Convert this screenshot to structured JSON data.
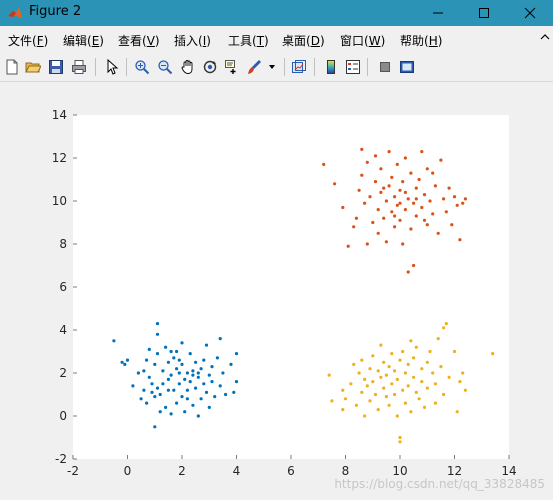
{
  "window": {
    "title": "Figure 2",
    "title_bar_color": "#2b93b5"
  },
  "menu": [
    {
      "label": "文件(",
      "key": "F",
      "end": ")"
    },
    {
      "label": "编辑(",
      "key": "E",
      "end": ")"
    },
    {
      "label": "查看(",
      "key": "V",
      "end": ")"
    },
    {
      "label": "插入(",
      "key": "I",
      "end": ")"
    },
    {
      "label": "工具(",
      "key": "T",
      "end": ")"
    },
    {
      "label": "桌面(",
      "key": "D",
      "end": ")"
    },
    {
      "label": "窗口(",
      "key": "W",
      "end": ")"
    },
    {
      "label": "帮助(",
      "key": "H",
      "end": ")"
    }
  ],
  "toolbar_icons": [
    "new-figure-icon",
    "open-file-icon",
    "save-icon",
    "print-icon",
    "pointer-icon",
    "zoom-in-icon",
    "zoom-out-icon",
    "pan-icon",
    "rotate-3d-icon",
    "data-cursor-icon",
    "brush-icon",
    "dropdown-icon",
    "link-plot-icon",
    "colorbar-icon",
    "legend-icon",
    "hide-plot-tools-icon",
    "show-plot-tools-icon"
  ],
  "watermark": "https://blog.csdn.net/qq_33828485",
  "chart_data": {
    "type": "scatter",
    "title": "",
    "xlabel": "",
    "ylabel": "",
    "xlim": [
      -2,
      14
    ],
    "ylim": [
      -2,
      14
    ],
    "xticks": [
      "-2",
      "0",
      "2",
      "4",
      "6",
      "8",
      "10",
      "12",
      "14"
    ],
    "yticks": [
      "-2",
      "0",
      "2",
      "4",
      "6",
      "8",
      "10",
      "12",
      "14"
    ],
    "grid": false,
    "series": [
      {
        "color": "#0072bd",
        "points": [
          [
            -0.5,
            3.5
          ],
          [
            -0.2,
            2.5
          ],
          [
            0.0,
            2.6
          ],
          [
            -0.1,
            2.4
          ],
          [
            0.2,
            1.4
          ],
          [
            0.4,
            2.0
          ],
          [
            0.5,
            0.8
          ],
          [
            0.6,
            2.1
          ],
          [
            0.6,
            1.2
          ],
          [
            0.7,
            2.6
          ],
          [
            0.7,
            0.6
          ],
          [
            0.8,
            1.8
          ],
          [
            0.8,
            3.1
          ],
          [
            0.9,
            1.1
          ],
          [
            0.9,
            1.5
          ],
          [
            1.0,
            -0.5
          ],
          [
            1.0,
            0.9
          ],
          [
            1.0,
            2.4
          ],
          [
            1.1,
            1.3
          ],
          [
            1.1,
            2.9
          ],
          [
            1.1,
            3.8
          ],
          [
            1.1,
            4.3
          ],
          [
            1.2,
            1.0
          ],
          [
            1.2,
            0.2
          ],
          [
            1.3,
            1.5
          ],
          [
            1.3,
            2.1
          ],
          [
            1.4,
            0.4
          ],
          [
            1.4,
            3.2
          ],
          [
            1.5,
            1.7
          ],
          [
            1.5,
            2.5
          ],
          [
            1.6,
            0.1
          ],
          [
            1.6,
            1.9
          ],
          [
            1.6,
            3.0
          ],
          [
            1.7,
            1.2
          ],
          [
            1.7,
            2.7
          ],
          [
            1.8,
            0.6
          ],
          [
            1.8,
            2.2
          ],
          [
            1.8,
            3.0
          ],
          [
            1.9,
            1.5
          ],
          [
            1.9,
            2.0
          ],
          [
            2.0,
            0.9
          ],
          [
            2.0,
            2.4
          ],
          [
            2.0,
            3.4
          ],
          [
            2.1,
            1.7
          ],
          [
            2.1,
            0.2
          ],
          [
            2.2,
            2.0
          ],
          [
            2.2,
            1.2
          ],
          [
            2.3,
            2.9
          ],
          [
            2.3,
            1.6
          ],
          [
            2.4,
            0.5
          ],
          [
            2.4,
            2.1
          ],
          [
            2.4,
            1.9
          ],
          [
            2.5,
            1.3
          ],
          [
            2.5,
            2.5
          ],
          [
            2.6,
            0.0
          ],
          [
            2.6,
            1.8
          ],
          [
            2.7,
            2.2
          ],
          [
            2.7,
            0.8
          ],
          [
            2.8,
            1.5
          ],
          [
            2.8,
            2.6
          ],
          [
            2.9,
            1.1
          ],
          [
            2.9,
            3.3
          ],
          [
            3.0,
            1.9
          ],
          [
            3.0,
            0.4
          ],
          [
            3.1,
            2.3
          ],
          [
            3.1,
            1.6
          ],
          [
            3.2,
            0.9
          ],
          [
            3.3,
            2.7
          ],
          [
            3.4,
            1.4
          ],
          [
            3.4,
            3.6
          ],
          [
            3.5,
            2.0
          ],
          [
            3.6,
            1.0
          ],
          [
            3.8,
            2.4
          ],
          [
            3.9,
            1.1
          ],
          [
            4.0,
            2.9
          ],
          [
            4.0,
            1.6
          ],
          [
            1.5,
            1.2
          ],
          [
            2.2,
            0.8
          ],
          [
            2.6,
            2.0
          ],
          [
            1.9,
            2.6
          ]
        ]
      },
      {
        "color": "#d95319",
        "points": [
          [
            7.2,
            11.7
          ],
          [
            7.6,
            10.8
          ],
          [
            7.9,
            9.7
          ],
          [
            8.1,
            7.9
          ],
          [
            8.3,
            8.8
          ],
          [
            8.4,
            9.2
          ],
          [
            8.5,
            10.5
          ],
          [
            8.6,
            11.2
          ],
          [
            8.6,
            12.4
          ],
          [
            8.7,
            9.9
          ],
          [
            8.8,
            8.0
          ],
          [
            8.8,
            11.8
          ],
          [
            8.9,
            10.2
          ],
          [
            9.0,
            9.0
          ],
          [
            9.1,
            10.9
          ],
          [
            9.1,
            12.1
          ],
          [
            9.2,
            8.5
          ],
          [
            9.2,
            9.6
          ],
          [
            9.3,
            10.4
          ],
          [
            9.3,
            11.5
          ],
          [
            9.4,
            9.2
          ],
          [
            9.5,
            10.0
          ],
          [
            9.5,
            8.1
          ],
          [
            9.6,
            10.7
          ],
          [
            9.6,
            12.3
          ],
          [
            9.7,
            9.5
          ],
          [
            9.7,
            11.1
          ],
          [
            9.8,
            10.2
          ],
          [
            9.8,
            8.8
          ],
          [
            9.9,
            9.8
          ],
          [
            9.9,
            11.7
          ],
          [
            10.0,
            10.5
          ],
          [
            10.0,
            9.1
          ],
          [
            10.1,
            8.0
          ],
          [
            10.1,
            10.9
          ],
          [
            10.2,
            9.6
          ],
          [
            10.2,
            12.0
          ],
          [
            10.3,
            10.1
          ],
          [
            10.3,
            6.7
          ],
          [
            10.4,
            8.7
          ],
          [
            10.4,
            11.3
          ],
          [
            10.5,
            9.9
          ],
          [
            10.5,
            7.0
          ],
          [
            10.6,
            10.6
          ],
          [
            10.6,
            9.3
          ],
          [
            10.7,
            11.0
          ],
          [
            10.8,
            9.7
          ],
          [
            10.8,
            12.3
          ],
          [
            10.9,
            10.3
          ],
          [
            11.0,
            8.9
          ],
          [
            11.0,
            11.5
          ],
          [
            11.1,
            10.0
          ],
          [
            11.2,
            9.4
          ],
          [
            11.2,
            11.3
          ],
          [
            11.3,
            10.7
          ],
          [
            11.4,
            8.5
          ],
          [
            11.5,
            11.9
          ],
          [
            11.6,
            10.1
          ],
          [
            11.7,
            9.5
          ],
          [
            11.8,
            10.6
          ],
          [
            11.9,
            8.9
          ],
          [
            12.0,
            10.2
          ],
          [
            12.1,
            9.8
          ],
          [
            12.2,
            8.2
          ],
          [
            12.3,
            9.9
          ],
          [
            12.4,
            10.1
          ],
          [
            10.0,
            9.9
          ],
          [
            9.4,
            10.6
          ],
          [
            10.2,
            10.4
          ],
          [
            10.6,
            10.1
          ],
          [
            9.8,
            9.3
          ],
          [
            10.9,
            9.1
          ]
        ]
      },
      {
        "color": "#edb120",
        "points": [
          [
            7.4,
            1.9
          ],
          [
            7.5,
            0.7
          ],
          [
            7.9,
            1.2
          ],
          [
            7.9,
            0.3
          ],
          [
            8.0,
            0.8
          ],
          [
            8.2,
            1.5
          ],
          [
            8.3,
            2.4
          ],
          [
            8.4,
            0.5
          ],
          [
            8.5,
            2.0
          ],
          [
            8.6,
            1.1
          ],
          [
            8.6,
            2.6
          ],
          [
            8.7,
            0.0
          ],
          [
            8.7,
            1.7
          ],
          [
            8.8,
            1.4
          ],
          [
            8.9,
            2.2
          ],
          [
            8.9,
            0.7
          ],
          [
            9.0,
            1.6
          ],
          [
            9.0,
            2.8
          ],
          [
            9.1,
            1.0
          ],
          [
            9.2,
            2.1
          ],
          [
            9.2,
            0.3
          ],
          [
            9.3,
            1.8
          ],
          [
            9.3,
            3.3
          ],
          [
            9.4,
            1.3
          ],
          [
            9.4,
            2.5
          ],
          [
            9.5,
            0.9
          ],
          [
            9.5,
            1.9
          ],
          [
            9.6,
            2.3
          ],
          [
            9.6,
            0.5
          ],
          [
            9.7,
            1.5
          ],
          [
            9.7,
            2.9
          ],
          [
            9.8,
            1.0
          ],
          [
            9.8,
            2.1
          ],
          [
            9.9,
            0.0
          ],
          [
            9.9,
            1.7
          ],
          [
            10.0,
            2.6
          ],
          [
            10.0,
            -1.2
          ],
          [
            10.0,
            -1.0
          ],
          [
            10.1,
            1.2
          ],
          [
            10.1,
            3.0
          ],
          [
            10.2,
            2.0
          ],
          [
            10.2,
            0.6
          ],
          [
            10.3,
            1.4
          ],
          [
            10.3,
            2.4
          ],
          [
            10.4,
            3.5
          ],
          [
            10.4,
            0.2
          ],
          [
            10.5,
            1.8
          ],
          [
            10.5,
            2.7
          ],
          [
            10.6,
            1.1
          ],
          [
            10.6,
            3.2
          ],
          [
            10.7,
            0.8
          ],
          [
            10.8,
            2.2
          ],
          [
            10.8,
            1.6
          ],
          [
            10.9,
            0.4
          ],
          [
            11.0,
            2.5
          ],
          [
            11.0,
            1.3
          ],
          [
            11.1,
            3.0
          ],
          [
            11.2,
            2.0
          ],
          [
            11.3,
            0.6
          ],
          [
            11.3,
            1.5
          ],
          [
            11.4,
            3.6
          ],
          [
            11.5,
            2.3
          ],
          [
            11.6,
            4.1
          ],
          [
            11.6,
            1.0
          ],
          [
            11.7,
            4.3
          ],
          [
            11.8,
            1.8
          ],
          [
            12.0,
            3.0
          ],
          [
            12.1,
            0.2
          ],
          [
            12.2,
            1.6
          ],
          [
            12.3,
            2.0
          ],
          [
            12.4,
            1.2
          ],
          [
            13.4,
            2.9
          ]
        ]
      }
    ]
  }
}
